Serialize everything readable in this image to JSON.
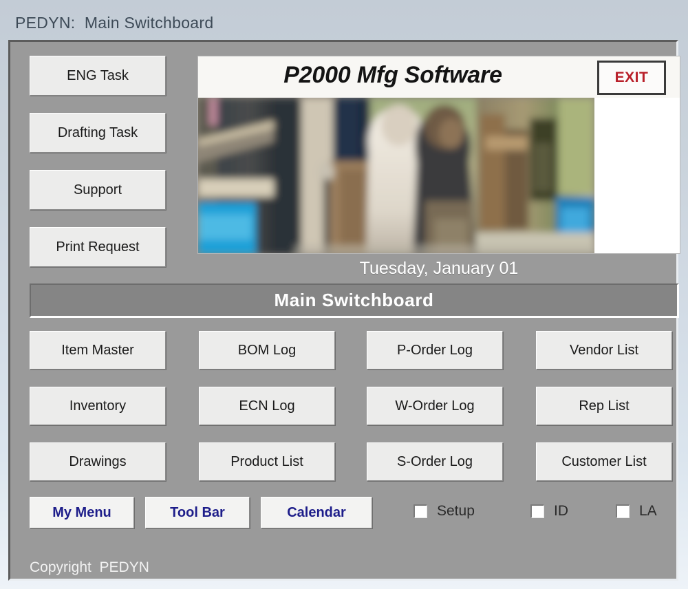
{
  "window": {
    "title": "PEDYN:  Main Switchboard"
  },
  "header": {
    "app_logo": "P2000 Mfg Software",
    "exit_label": "EXIT",
    "photo_alt": "workshop-photo",
    "date": "Tuesday, January 01"
  },
  "banner": {
    "title": "Main Switchboard"
  },
  "left_tasks": [
    {
      "label": "ENG Task"
    },
    {
      "label": "Drafting Task"
    },
    {
      "label": "Support"
    },
    {
      "label": "Print Request"
    }
  ],
  "grid": {
    "columns": [
      {
        "items": [
          {
            "label": "Item Master"
          },
          {
            "label": "Inventory"
          },
          {
            "label": "Drawings"
          }
        ]
      },
      {
        "items": [
          {
            "label": "BOM Log"
          },
          {
            "label": "ECN Log"
          },
          {
            "label": "Product List"
          }
        ]
      },
      {
        "items": [
          {
            "label": "P-Order Log"
          },
          {
            "label": "W-Order Log"
          },
          {
            "label": "S-Order Log"
          }
        ]
      },
      {
        "items": [
          {
            "label": "Vendor List"
          },
          {
            "label": "Rep List"
          },
          {
            "label": "Customer List"
          }
        ]
      }
    ]
  },
  "bottom_buttons": [
    {
      "label": "My Menu"
    },
    {
      "label": "Tool Bar"
    },
    {
      "label": "Calendar"
    }
  ],
  "checkboxes": [
    {
      "label": "Setup",
      "checked": false
    },
    {
      "label": "ID",
      "checked": false
    },
    {
      "label": "LA",
      "checked": false
    }
  ],
  "footer": {
    "copyright": "Copyright  PEDYN"
  },
  "colors": {
    "form_background": "#9a9a9a",
    "button_face": "#ececeb",
    "banner_background": "#858585",
    "exit_text": "#b9202a",
    "small_button_text": "#1d1d8a",
    "titlebar_text": "#3d4a57"
  }
}
